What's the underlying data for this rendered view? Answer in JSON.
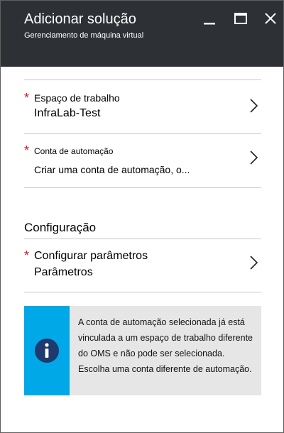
{
  "header": {
    "title": "Adicionar solução",
    "subtitle": "Gerenciamento de máquina virtual"
  },
  "window_controls": {
    "minimize_icon": "minimize-icon",
    "maximize_icon": "maximize-icon",
    "close_icon": "close-icon"
  },
  "fields": {
    "workspace": {
      "required_marker": "*",
      "label": "Espaço de trabalho",
      "value": "InfraLab-Test"
    },
    "automation_account": {
      "required_marker": "*",
      "label": "Conta de automação",
      "value": "Criar uma conta de automação, o..."
    }
  },
  "configuration": {
    "section_title": "Configuração",
    "parameters": {
      "required_marker": "*",
      "label": "Configurar parâmetros",
      "value": "Parâmetros"
    }
  },
  "info": {
    "icon": "info-icon",
    "message": "A conta de automação selecionada já está vinculada a um espaço de trabalho diferente do OMS e não pode ser selecionada. Escolha uma conta diferente de automação."
  },
  "colors": {
    "header_bg": "#2d3136",
    "required": "#e81123",
    "info_accent": "#00a8e8",
    "info_bg": "#e6e6e6"
  }
}
